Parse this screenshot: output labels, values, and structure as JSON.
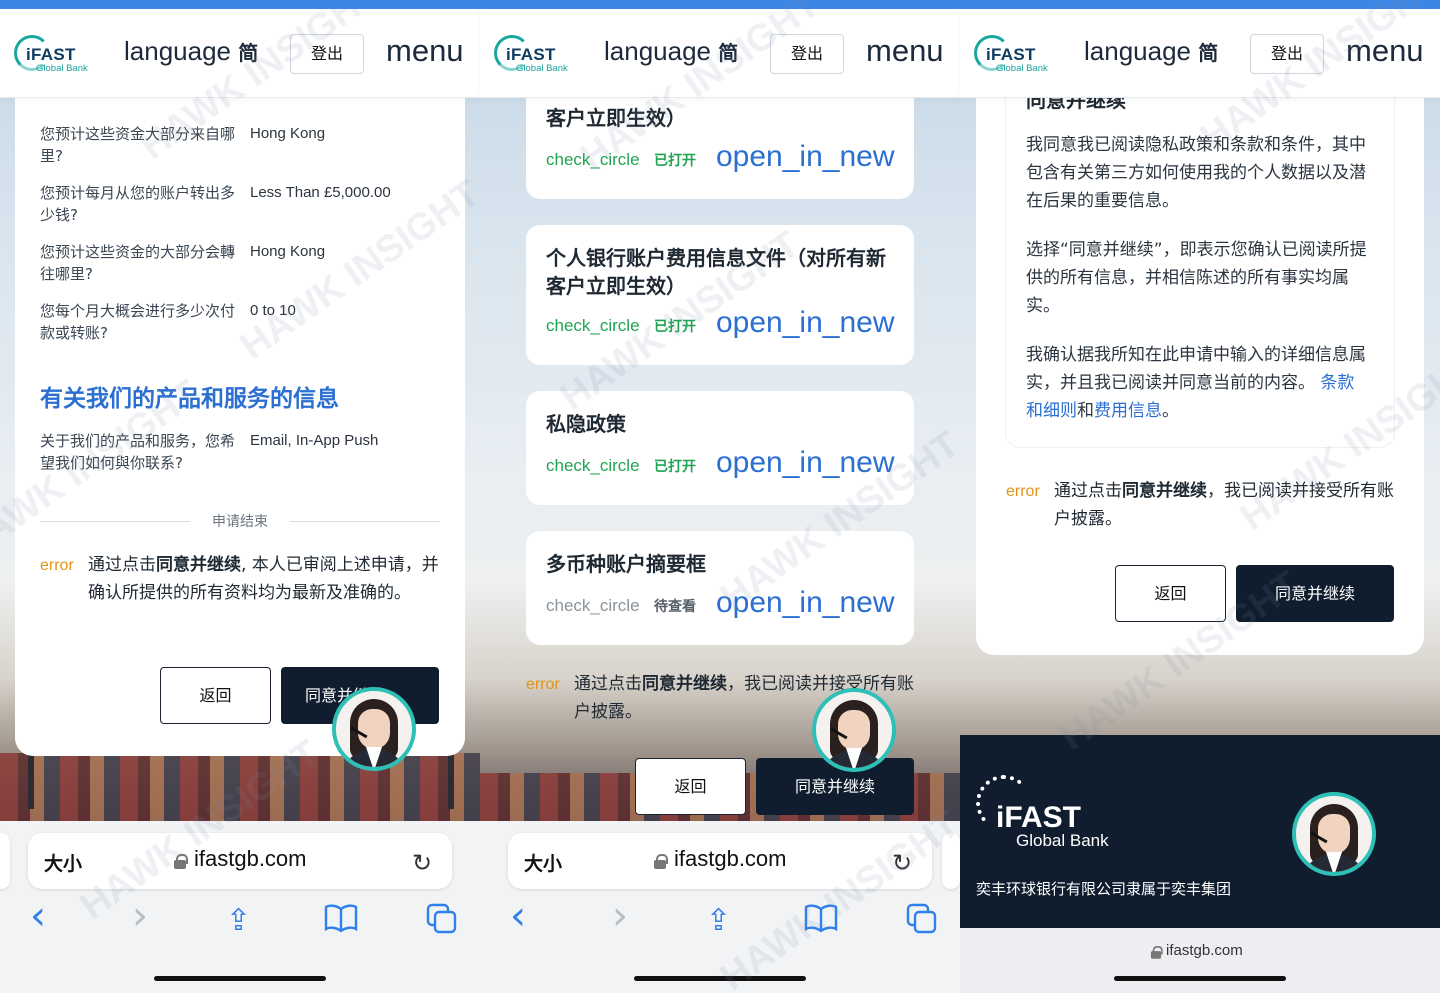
{
  "header": {
    "logo_main": "iFAST",
    "logo_sub": "Global Bank",
    "language_label": "language",
    "language_glyph": "简",
    "logout_label": "登出",
    "menu_label": "menu"
  },
  "panel1": {
    "qa": [
      {
        "q": "您预计这些资金大部分来自哪里?",
        "a": "Hong Kong"
      },
      {
        "q": "您预计每月从您的账户转出多少钱?",
        "a": "Less Than £5,000.00"
      },
      {
        "q": "您预计这些资金的大部分会轉往哪里?",
        "a": "Hong Kong"
      },
      {
        "q": "您每个月大概会进行多少次付款或转账?",
        "a": "0 to 10"
      }
    ],
    "section_title": "有关我们的产品和服务的信息",
    "contact_q": "关于我们的产品和服务，您希望我们如何與你联系?",
    "contact_a": "Email, In-App Push",
    "end_label": "申请结束",
    "error_icon": "error",
    "error_text_pre": "通过点击",
    "error_text_bold": "同意并继续",
    "error_text_post": ", 本人已审阅上述申请，并确认所提供的所有资料均为最新及准确的。",
    "back_label": "返回",
    "agree_label": "同意并继续"
  },
  "panel2": {
    "docs": [
      {
        "title": "客户立即生效）",
        "check": "check_circle",
        "status": "已打开",
        "open": "open_in_new",
        "state": "opened"
      },
      {
        "title": "个人银行账户费用信息文件（对所有新客户立即生效）",
        "check": "check_circle",
        "status": "已打开",
        "open": "open_in_new",
        "state": "opened"
      },
      {
        "title": "私隐政策",
        "check": "check_circle",
        "status": "已打开",
        "open": "open_in_new",
        "state": "opened"
      },
      {
        "title": "多币种账户摘要框",
        "check": "check_circle",
        "status": "待查看",
        "open": "open_in_new",
        "state": "pending"
      }
    ],
    "error_icon": "error",
    "error_text_pre": "通过点击",
    "error_text_bold": "同意并继续",
    "error_text_post": "，我已阅读并接受所有账户披露。",
    "back_label": "返回",
    "agree_label": "同意并继续"
  },
  "panel3": {
    "cut_heading": "同意并继续",
    "para1": "我同意我已阅读隐私政策和条款和条件，其中包含有关第三方如何使用我的个人数据以及潜在后果的重要信息。",
    "para2": "选择“同意并继续”，即表示您确认已阅读所提供的所有信息，并相信陈述的所有事实均属实。",
    "para3_pre": "我确认据我所知在此申请中输入的详细信息属实，并且我已阅读并同意当前的内容。",
    "link1": "条款和细则",
    "para3_mid": "和",
    "link2": "费用信息",
    "para3_end": "。",
    "error_icon": "error",
    "error_text_pre": "通过点击",
    "error_text_bold": "同意并继续",
    "error_text_post": "，我已阅读并接受所有账户披露。",
    "back_label": "返回",
    "agree_label": "同意并继续",
    "footer_logo_main": "iFAST",
    "footer_logo_sub": "Global Bank",
    "footer_text": "奕丰环球银行有限公司隶属于奕丰集团",
    "mini_url": "ifastgb.com"
  },
  "browser": {
    "aa_label": "大小",
    "url": "ifastgb.com",
    "reload_icon": "↻",
    "back_icon": "‹",
    "forward_icon": "›",
    "share_icon": "⇪",
    "bookmarks_icon": "📖",
    "tabs_icon": "⧉"
  },
  "watermark": "HAWK INSIGHT",
  "colors": {
    "accent_blue": "#2a6fd1",
    "teal": "#18a6a0",
    "navy": "#0f1d2e",
    "error_orange": "#e39415",
    "green": "#21a452",
    "gray": "#8a939c"
  }
}
